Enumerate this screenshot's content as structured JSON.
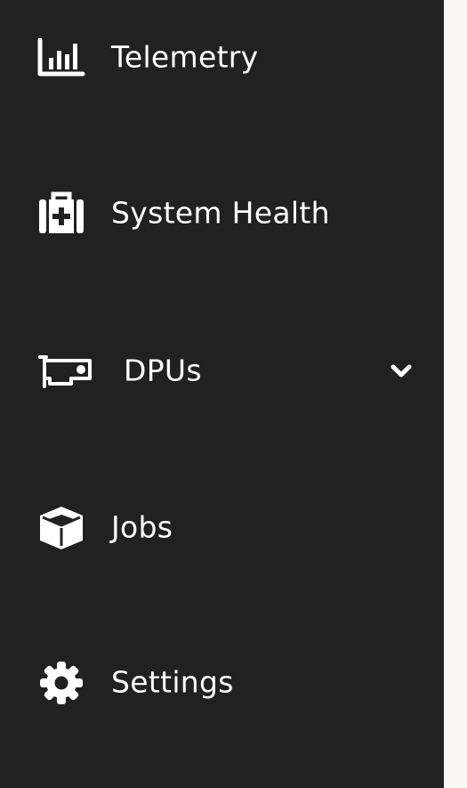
{
  "sidebar": {
    "items": [
      {
        "label": "Telemetry",
        "icon": "bar-chart-icon"
      },
      {
        "label": "System Health",
        "icon": "first-aid-kit-icon"
      },
      {
        "label": "DPUs",
        "icon": "network-card-icon",
        "expandable": true,
        "expand_icon": "chevron-down-icon"
      },
      {
        "label": "Jobs",
        "icon": "cube-icon"
      },
      {
        "label": "Settings",
        "icon": "gear-icon"
      }
    ]
  },
  "colors": {
    "sidebar_bg": "#212121",
    "text": "#ffffff",
    "page_bg": "#f7f6f5"
  }
}
